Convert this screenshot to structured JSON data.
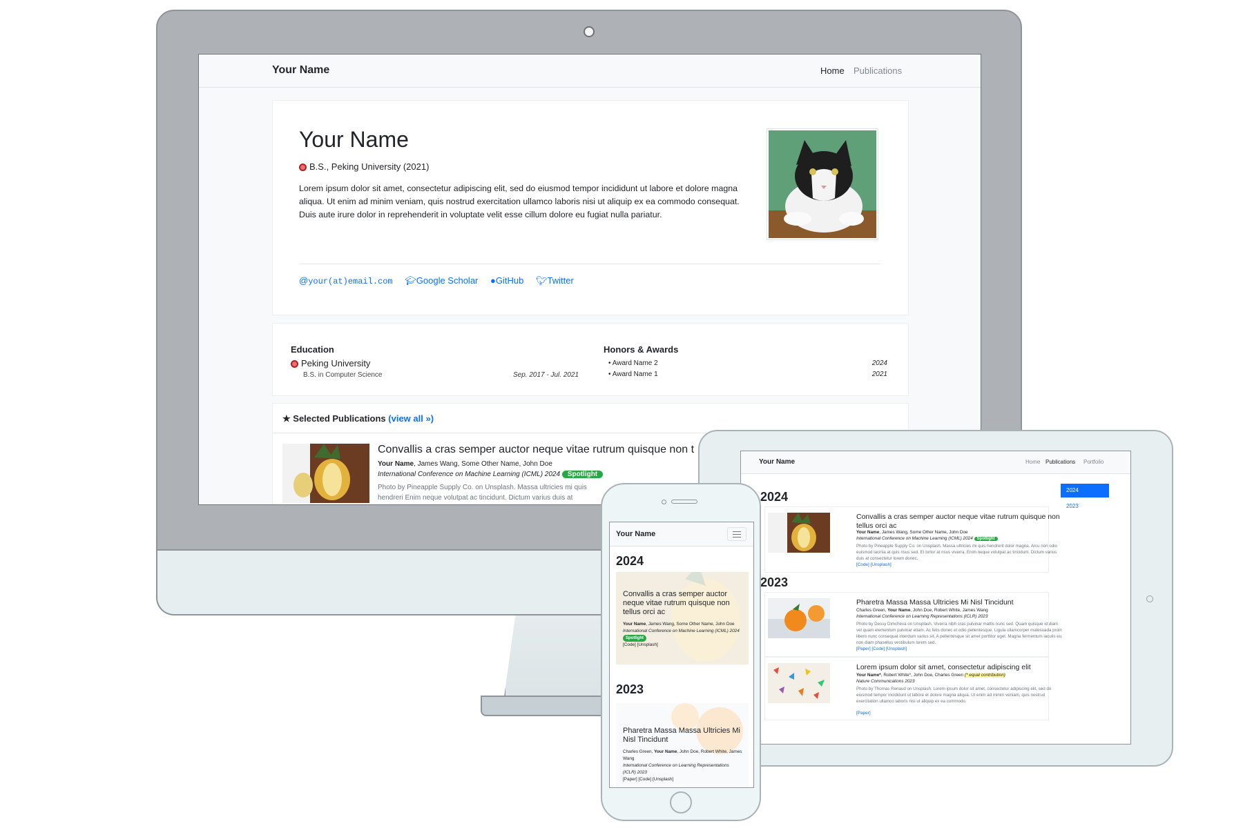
{
  "desktop": {
    "brand": "Your Name",
    "nav": {
      "home": "Home",
      "publications": "Publications"
    },
    "hero": {
      "name": "Your Name",
      "degree": "B.S., Peking University (2021)",
      "bio": "Lorem ipsum dolor sit amet, consectetur adipiscing elit, sed do eiusmod tempor incididunt ut labore et dolore magna aliqua. Ut enim ad minim veniam, quis nostrud exercitation ullamco laboris nisi ut aliquip ex ea commodo consequat. Duis aute irure dolor in reprehenderit in voluptate velit esse cillum dolore eu fugiat nulla pariatur.",
      "links": {
        "email": "your(at)email.com",
        "scholar": "Google Scholar",
        "github": "GitHub",
        "twitter": "Twitter"
      }
    },
    "education": {
      "title": "Education",
      "school": "Peking University",
      "degree": "B.S. in Computer Science",
      "dates": "Sep. 2017 - Jul. 2021"
    },
    "awards": {
      "title": "Honors & Awards",
      "items": [
        {
          "name": "Award Name 2",
          "year": "2024"
        },
        {
          "name": "Award Name 1",
          "year": "2021"
        }
      ]
    },
    "selected_publications": {
      "title": "Selected Publications",
      "view_all": "(view all",
      "pub": {
        "title": "Convallis a cras semper auctor neque vitae rutrum quisque non t",
        "author_self": "Your Name",
        "authors_rest": ", James Wang, Some Other Name, John Doe",
        "venue": "International Conference on Machine Learning (ICML) 2024",
        "badge": "Spotlight",
        "desc": "Photo by Pineapple Supply Co. on Unsplash. Massa ultricies mi quis hendreri Enim neque volutpat ac tincidunt. Dictum varius duis at consectetur lore"
      }
    }
  },
  "tablet": {
    "brand": "Your Name",
    "nav": {
      "home": "Home",
      "publications": "Publications",
      "portfolio": "Portfolio"
    },
    "sidebar": {
      "active": "2024",
      "other": "2023"
    },
    "years": {
      "y2024": "2024",
      "y2023": "2023"
    },
    "pubs": [
      {
        "title": "Convallis a cras semper auctor neque vitae rutrum quisque non tellus orci ac",
        "author_self": "Your Name",
        "authors_rest": ", James Wang, Some Other Name, John Doe",
        "venue": "International Conference on Machine Learning (ICML) 2024",
        "badge": "Spotlight",
        "desc": "Photo by Pineapple Supply Co. on Unsplash. Massa ultricies mi quis hendrerit dolor magna. Arcu non odio euismod lacinia at quis risus sed. Et tortor at risus viverra. Enim neque volutpat ac tincidunt. Dictum varius duis at consectetur lorem donec.",
        "links": "[Code] [Unsplash]"
      },
      {
        "title": "Pharetra Massa Massa Ultricies Mi Nisl Tincidunt",
        "authors_pre": "Charles Green, ",
        "author_self": "Your Name",
        "authors_rest": ", John Doe, Robert White, James Wang",
        "venue": "International Conference on Learning Representations (ICLR) 2023",
        "desc": "Photo by Dessy Dimcheva on Unsplash. Viverra nibh cras pulvinar mattis nunc sed. Quam quisque id diam vel quam elementum pulvinar etiam. Ac felis donec et odio pellentesque. Ligula ullamcorper malesuada proin libero nunc consequat interdum varius sit. A pellentesque sit amet porttitor eget. Magna fermentum iaculis eu non diam phasellus vestibulum lorem sed.",
        "links": "[Paper] [Code] [Unsplash]"
      },
      {
        "title": "Lorem ipsum dolor sit amet, consectetur adipiscing elit",
        "author_self": "Your Name*",
        "authors_rest": ", Robert White*, John Doe, Charles Green",
        "contrib": "(* equal contribution)",
        "venue": "Nature Communications 2023",
        "desc": "Photo by Thomas Renaud on Unsplash. Lorem ipsum dolor sit amet, consectetur adipiscing elit, sed do eiusmod tempor incididunt ut labore et dolore magna aliqua. Ut enim ad minim veniam, quis nostrud exercitation ullamco laboris nisi ut aliquip ex ea commodo.",
        "links": "[Paper]"
      }
    ]
  },
  "phone": {
    "brand": "Your Name",
    "years": {
      "y2024": "2024",
      "y2023": "2023"
    },
    "pubs": [
      {
        "title": "Convallis a cras semper auctor neque vitae rutrum quisque non tellus orci ac",
        "author_self": "Your Name",
        "authors_rest": ", James Wang, Some Other Name, John Doe",
        "venue": "International Conference on Machine Learning (ICML) 2024",
        "badge": "Spotlight",
        "links": "[Code] [Unsplash]"
      },
      {
        "title": "Pharetra Massa Massa Ultricies Mi Nisl Tincidunt",
        "authors_pre": "Charles Green, ",
        "author_self": "Your Name",
        "authors_rest": ", John Doe, Robert White, James Wang",
        "venue": "International Conference on Learning Representations (ICLR) 2023",
        "links": "[Paper] [Code] [Unsplash]"
      }
    ]
  },
  "colors": {
    "link": "#0d6efd",
    "badge": "#28a745",
    "frame": "#aeb2b6",
    "device": "#e7eff1"
  }
}
